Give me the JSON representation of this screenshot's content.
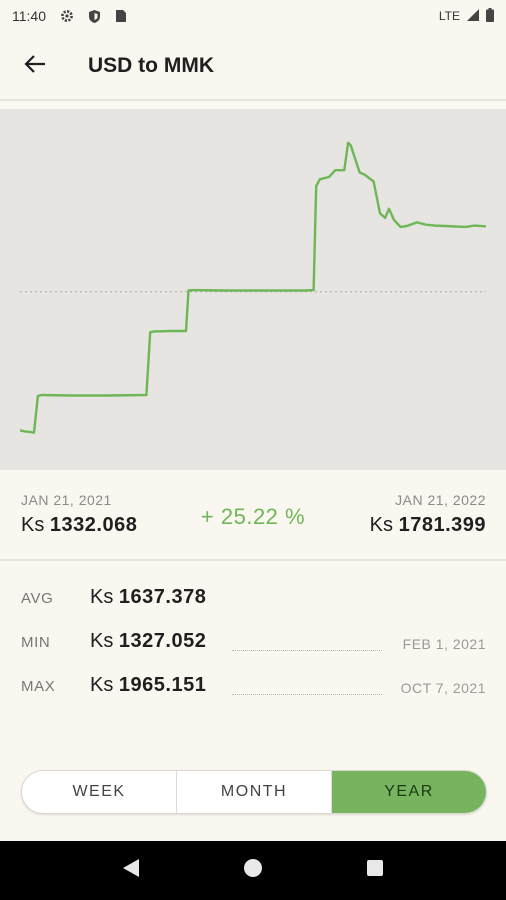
{
  "status_bar": {
    "time": "11:40",
    "network": "LTE",
    "icons": [
      "gear-icon",
      "shield-icon",
      "sim-card-icon",
      "signal-icon",
      "battery-icon"
    ]
  },
  "app_bar": {
    "title": "USD to MMK",
    "back_icon": "arrow-left-icon"
  },
  "summary": {
    "start_date": "JAN 21, 2021",
    "start_currency": "Ks",
    "start_value": "1332.068",
    "change": "+ 25.22 %",
    "end_date": "JAN 21, 2022",
    "end_currency": "Ks",
    "end_value": "1781.399"
  },
  "stats": {
    "avg": {
      "label": "AVG",
      "currency": "Ks",
      "value": "1637.378"
    },
    "min": {
      "label": "MIN",
      "currency": "Ks",
      "value": "1327.052",
      "date": "FEB 1, 2021"
    },
    "max": {
      "label": "MAX",
      "currency": "Ks",
      "value": "1965.151",
      "date": "OCT 7, 2021"
    }
  },
  "range": {
    "options": [
      "WEEK",
      "MONTH",
      "YEAR"
    ],
    "selected": "YEAR"
  },
  "colors": {
    "line": "#6fb657",
    "accent": "#78b35f",
    "chart_bg": "#e6e5e1",
    "page_bg": "#faf7f0"
  },
  "chart_data": {
    "type": "line",
    "x_start": "2021-01-21",
    "x_end": "2022-01-21",
    "average_reference_line": 1637.378,
    "series": [
      {
        "x": [
          "2021-01-21",
          "2021-01-25",
          "2021-01-28",
          "2021-02-01",
          "2021-02-04",
          "2021-02-07",
          "2021-03-01",
          "2021-04-01",
          "2021-04-30",
          "2021-05-03",
          "2021-05-06",
          "2021-05-20",
          "2021-05-31",
          "2021-06-02",
          "2021-06-05",
          "2021-07-01",
          "2021-08-01",
          "2021-09-01",
          "2021-09-08",
          "2021-09-10",
          "2021-09-13",
          "2021-09-20",
          "2021-09-25",
          "2021-10-02",
          "2021-10-05",
          "2021-10-07",
          "2021-10-14",
          "2021-10-18",
          "2021-10-25",
          "2021-10-30",
          "2021-11-03",
          "2021-11-06",
          "2021-11-10",
          "2021-11-15",
          "2021-11-20",
          "2021-11-28",
          "2021-12-05",
          "2021-12-12",
          "2021-12-20",
          "2021-12-28",
          "2022-01-05",
          "2022-01-12",
          "2022-01-21"
        ],
        "y": [
          1332.068,
          1330,
          1329,
          1327.052,
          1408,
          1410,
          1409,
          1409,
          1410,
          1548,
          1550,
          1551,
          1551,
          1640,
          1641,
          1640,
          1640,
          1640,
          1641,
          1870,
          1885,
          1890,
          1905,
          1905,
          1965.151,
          1960,
          1900,
          1895,
          1880,
          1810,
          1800,
          1820,
          1795,
          1780,
          1782,
          1790,
          1785,
          1783,
          1782,
          1781,
          1780,
          1783,
          1781.399
        ]
      }
    ],
    "ylim": [
      1300,
      2000
    ]
  }
}
